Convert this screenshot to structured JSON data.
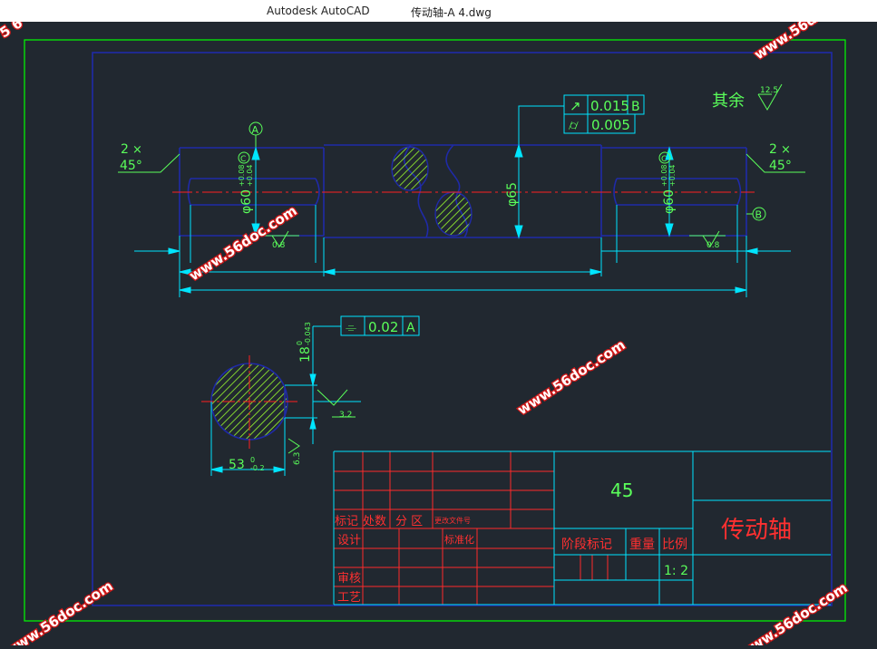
{
  "window": {
    "app_name": "Autodesk AutoCAD",
    "file_name": "传动轴-A 4.dwg"
  },
  "watermark": {
    "text": "www.56doc.com",
    "partial": "www.56d",
    "corner_partial": "5 6"
  },
  "drawing": {
    "roughness_note": {
      "label": "其余",
      "value": "12.5"
    },
    "chamfer_left": {
      "count": "2",
      "angle": "45°"
    },
    "chamfer_right": {
      "count": "2",
      "angle": "45°"
    },
    "datum_a": "A",
    "datum_b": "B",
    "datum_c": "C",
    "fcf_top": [
      {
        "symbol": "↗",
        "value": "0.015",
        "datum": "B"
      },
      {
        "symbol": "⌭",
        "value": "0.005",
        "datum": ""
      }
    ],
    "fcf_section": {
      "symbol": "⌯",
      "value": "0.02",
      "datum": "A"
    },
    "dia_left": "φ60",
    "dia_left_tol_upper": "+0.08",
    "dia_left_tol_lower": "+0.04",
    "dia_right": "φ60",
    "dia_right_tol_upper": "+0.08",
    "dia_right_tol_lower": "+0.04",
    "dia_mid": "φ65",
    "roughness_values": [
      "0.8",
      "0.8",
      "3.2",
      "6.3"
    ],
    "keyway_width": "18",
    "keyway_width_tol_upper": "0",
    "keyway_width_tol_lower": "-0.043",
    "keyway_depth": "53",
    "keyway_depth_tol_upper": "0",
    "keyway_depth_tol_lower": "-0.2"
  },
  "title_block": {
    "material": "45",
    "part_name": "传动轴",
    "headers": [
      "标记",
      "处数",
      "分 区",
      "更改文件号"
    ],
    "row_labels": [
      "设计",
      "审核",
      "工艺"
    ],
    "standardize": "标准化",
    "stage_mark": "阶段标记",
    "weight": "重量",
    "scale_label": "比例",
    "scale_value": "1: 2"
  },
  "colors": {
    "background": "#212830",
    "frame": "#00ff00",
    "geometry": "#1f2aa8",
    "dimension": "#00e5ff",
    "centerline": "#ff1f1f",
    "text_green": "#5aff5a",
    "text_red": "#ff3030",
    "hatch": "#9cff2e"
  }
}
